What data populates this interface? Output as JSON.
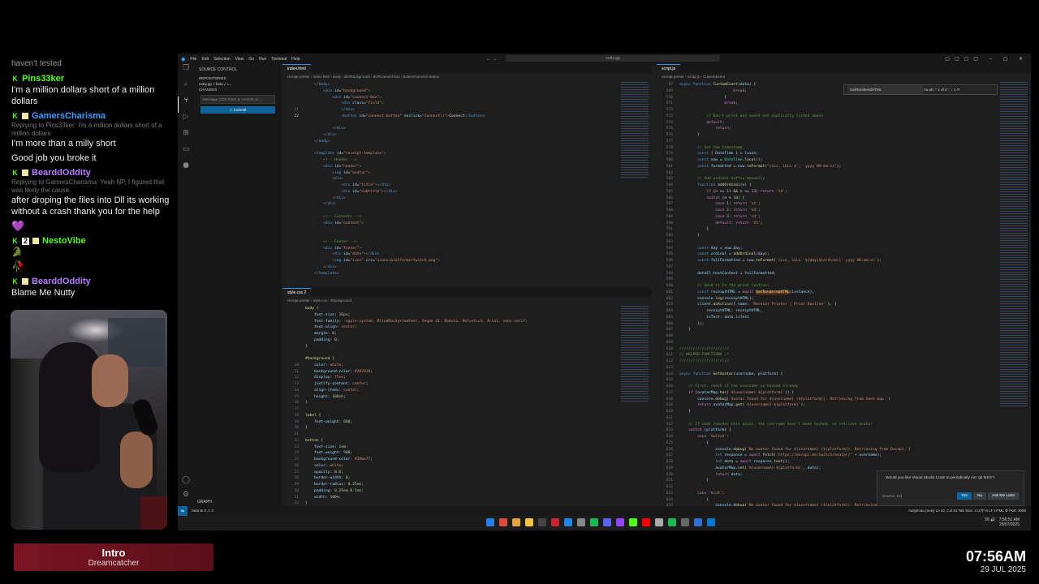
{
  "chat": [
    {
      "type": "plain",
      "text": "haven't tested"
    },
    {
      "type": "msg",
      "user": "Pins33ker",
      "color": "#53fc18",
      "badges": [
        "k"
      ],
      "text": "I'm a million dollars short of a million dollars"
    },
    {
      "type": "msg",
      "user": "GamersCharisma",
      "color": "#3a9cff",
      "badges": [
        "k",
        "sub"
      ],
      "reply": "Replying to Pins33ker: I'm a million dollars short of a million dollars",
      "text": "I'm more than a milly short"
    },
    {
      "type": "cont",
      "text": "Good job you broke it"
    },
    {
      "type": "msg",
      "user": "BearddOddity",
      "color": "#b77cff",
      "badges": [
        "k",
        "sub"
      ],
      "reply": "Replying to GamersCharisma: Yeah NP, I figured that was likely the cause",
      "text": "after droping the files into Dll its working without a crash thank you for the help"
    },
    {
      "type": "emote",
      "text": "💜"
    },
    {
      "type": "msg",
      "user": "NestoVibe",
      "color": "#53fc18",
      "badges": [
        "k",
        "2",
        "sub"
      ],
      "text": "🐊"
    },
    {
      "type": "emote",
      "text": "🥀"
    },
    {
      "type": "msg",
      "user": "BearddOddity",
      "color": "#b77cff",
      "badges": [
        "k",
        "sub"
      ],
      "text": "Blame Me Nutty"
    }
  ],
  "song": {
    "title": "Intro",
    "artist": "Dreamcatcher"
  },
  "clock": {
    "time": "07:56AM",
    "date": "29 JUL 2025"
  },
  "vscode": {
    "menus": [
      "File",
      "Edit",
      "Selection",
      "View",
      "Go",
      "Run",
      "Terminal",
      "Help"
    ],
    "search": "nutty.gg",
    "sidebar": {
      "title": "SOURCE CONTROL",
      "repositories": "REPOSITORIES",
      "repo": "nutty.gg",
      "branch": "beta",
      "changes": "CHANGES",
      "message_placeholder": "Message (Ctrl+Enter to commit on...",
      "commit": "✓ Commit",
      "graph": "GRAPH"
    },
    "left_top": {
      "tab": "index.html",
      "crumb": "receipt-printer › index.html › body › div#background › div#connect-box › button#connect-button"
    },
    "left_bottom": {
      "tab": "style.css  2",
      "crumb": "receipt-printer › style.css › #background"
    },
    "right": {
      "tab": "script.js",
      "crumb": "receipt-printer › script.js › CustomEvent",
      "find_query": "GetRenderedHTML",
      "find_count": "1 of 2",
      "hover_url": "https://kick.com/tonewvillevub"
    },
    "notification": {
      "message": "Would you like Visual Studio Code to periodically run 'git fetch'?",
      "source": "Source: Git",
      "yes": "Yes",
      "no": "No",
      "later": "Ask Me Later"
    },
    "status": {
      "branch": "beta",
      "problems": "⊗ 0 ⚠ 2",
      "right": "nuttylmao (now)   Ln 22, Col 51   Tab Size: 4   UTF-8   LF   HTML   ⚙   Port: 3000"
    }
  },
  "taskbar": {
    "tray_time": "7:56:51 AM",
    "tray_date": "29/07/2025",
    "tray_num": "56"
  }
}
